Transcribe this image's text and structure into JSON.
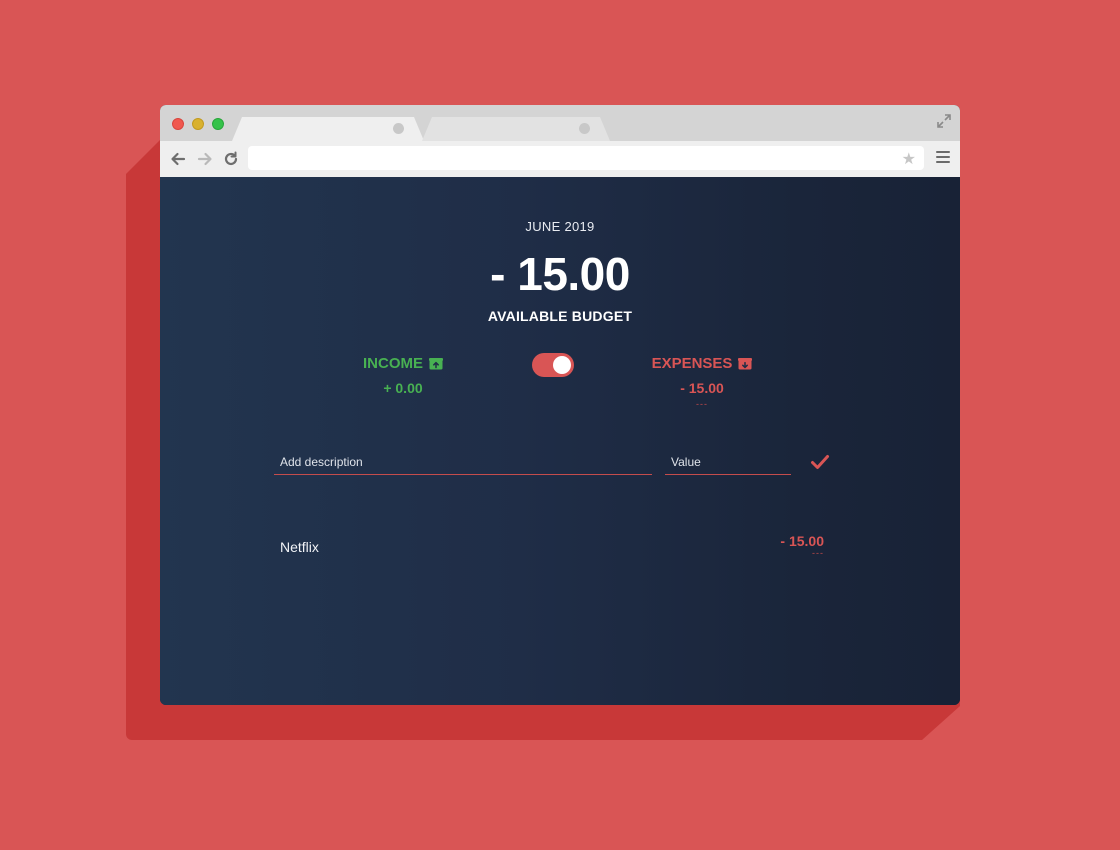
{
  "app": {
    "month": "JUNE 2019",
    "budget": "- 15.00",
    "budget_label": "AVAILABLE BUDGET"
  },
  "income": {
    "label": "INCOME",
    "value": "+ 0.00",
    "icon": "box-up-icon",
    "color": "#48b152"
  },
  "expenses": {
    "label": "EXPENSES",
    "value": "- 15.00",
    "percentage": "---",
    "icon": "box-down-icon",
    "color": "#d95555"
  },
  "toggle": {
    "state": "on",
    "color": "#d95555"
  },
  "form": {
    "description_placeholder": "Add description",
    "value_placeholder": "Value"
  },
  "items": [
    {
      "description": "Netflix",
      "value": "- 15.00",
      "percentage": "---"
    }
  ],
  "colors": {
    "page_background": "#d95555",
    "app_background": "#1f2d47",
    "accent": "#d95555",
    "positive": "#48b152"
  }
}
